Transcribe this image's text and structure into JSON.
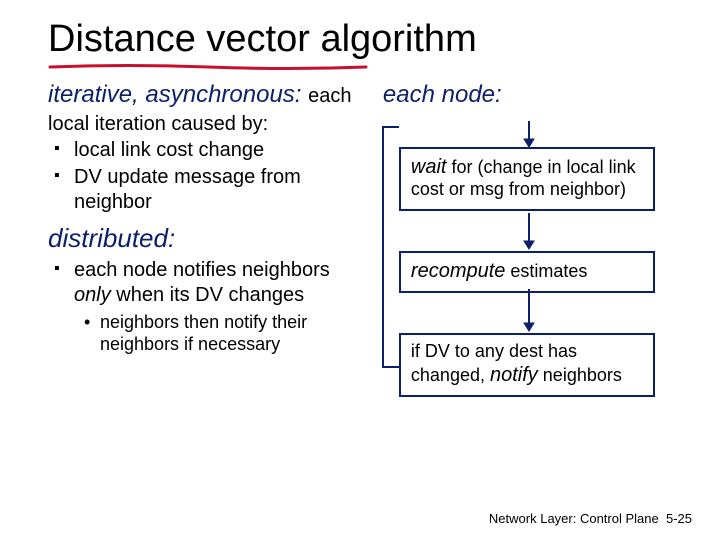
{
  "title": "Distance vector algorithm",
  "left": {
    "iter_heading": "iterative, asynchronous:",
    "iter_sub": "each local iteration caused by:",
    "iter_b1": "local link cost change",
    "iter_b2": "DV update message from neighbor",
    "dist_heading": "distributed:",
    "dist_b1_a": "each node notifies neighbors ",
    "dist_b1_only": "only",
    "dist_b1_b": " when its DV changes",
    "dist_sub": "neighbors then notify their neighbors if necessary"
  },
  "right": {
    "each_node": "each node:",
    "box1_lead": "wait",
    "box1_rest": " for (change in local link cost or msg from neighbor)",
    "box2_lead": "recompute",
    "box2_rest": " estimates",
    "box3_a": "if DV to any dest has changed, ",
    "box3_notify": "notify",
    "box3_b": " neighbors"
  },
  "footer": {
    "label": "Network Layer: Control Plane",
    "page": "5-25"
  }
}
